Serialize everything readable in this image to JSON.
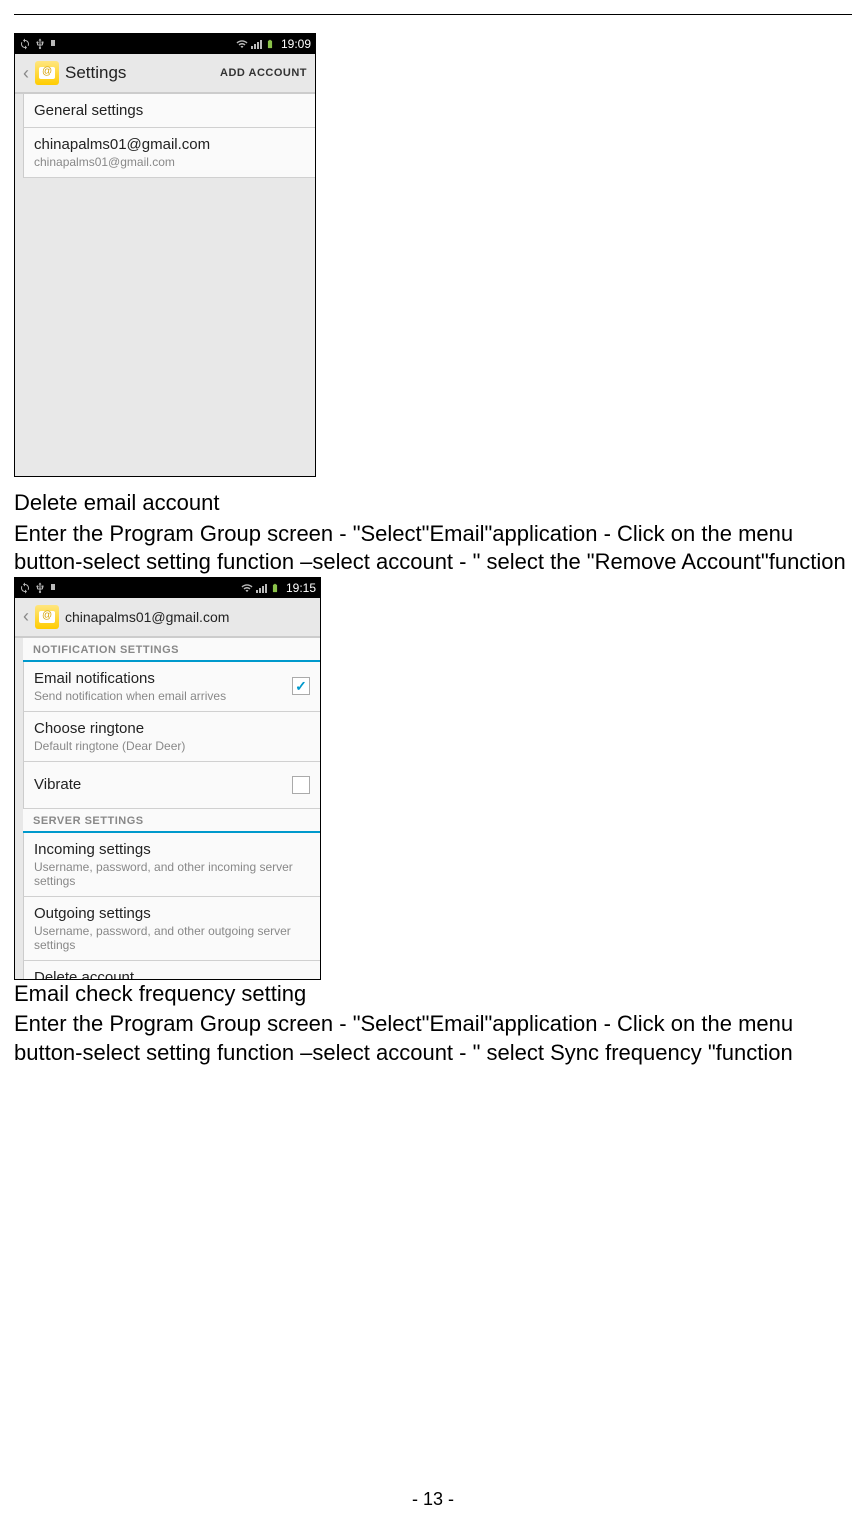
{
  "screenshot1": {
    "time": "19:09",
    "header_title": "Settings",
    "add_account": "ADD ACCOUNT",
    "general_settings": "General settings",
    "account_title": "chinapalms01@gmail.com",
    "account_sub": "chinapalms01@gmail.com"
  },
  "section1": {
    "title": "Delete email account",
    "body": "Enter the Program Group screen - \"Select\"Email\"application - Click on the menu button-select setting function –select account - \" select the \"Remove Account\"function"
  },
  "screenshot2": {
    "time": "19:15",
    "header_title": "chinapalms01@gmail.com",
    "notification_settings": "NOTIFICATION SETTINGS",
    "email_notif_title": "Email notifications",
    "email_notif_sub": "Send notification when email arrives",
    "ringtone_title": "Choose ringtone",
    "ringtone_sub": "Default ringtone (Dear Deer)",
    "vibrate_title": "Vibrate",
    "server_settings": "SERVER SETTINGS",
    "incoming_title": "Incoming settings",
    "incoming_sub": "Username, password, and other incoming server settings",
    "outgoing_title": "Outgoing settings",
    "outgoing_sub": "Username, password, and other outgoing server settings",
    "delete_account": "Delete account"
  },
  "section2": {
    "title": "Email check frequency setting",
    "body": "Enter the Program Group screen - \"Select\"Email\"application - Click on the menu button-select setting function –select account - \" select Sync frequency \"function"
  },
  "page_number": "- 13 -"
}
